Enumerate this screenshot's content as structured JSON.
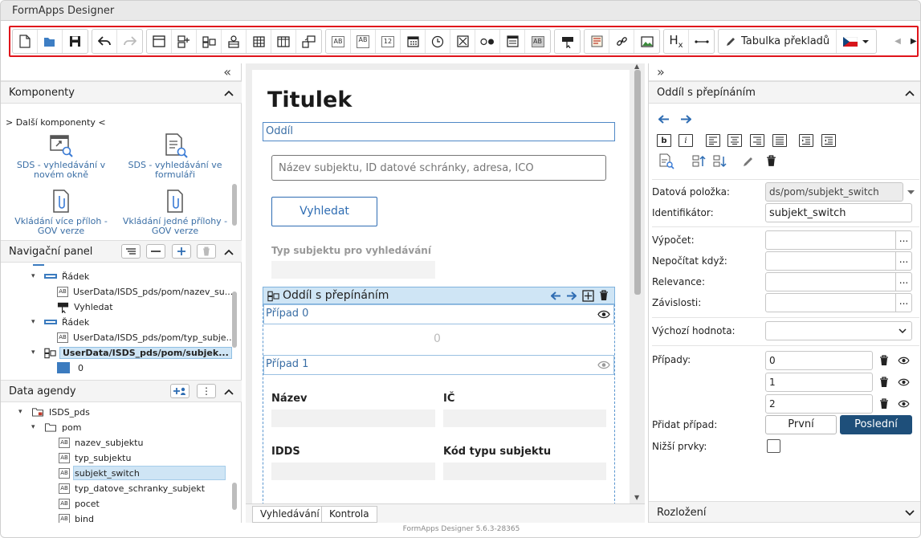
{
  "window": {
    "title": "FormApps Designer"
  },
  "toolbar": {
    "translations_label": "Tabulka překladů",
    "field_text_icon": "AB",
    "field_number_icon": "12",
    "field_readonly_icon": "AB",
    "field_textarea_icon": "AB",
    "heading_icon_letter": "H",
    "heading_icon_sub": "x",
    "language": "cs",
    "flag_colors": [
      "#ffffff",
      "#d7141a",
      "#11457e"
    ]
  },
  "left": {
    "components": {
      "title": "Komponenty",
      "more_link": "> Další komponenty <",
      "items": [
        {
          "label": "SDS - vyhledávání v novém okně",
          "icon": "window-search-icon"
        },
        {
          "label": "SDS - vyhledávání ve formuláři",
          "icon": "form-search-icon"
        },
        {
          "label": "Vkládání více příloh - GOV verze",
          "icon": "attachment-multi-icon"
        },
        {
          "label": "Vkládání jedné přílohy - GOV verze",
          "icon": "attachment-single-icon"
        }
      ]
    },
    "navigation": {
      "title": "Navigační panel",
      "rows": [
        {
          "label": "Řádek",
          "type": "row"
        },
        {
          "label": "UserData/ISDS_pds/pom/nazev_su...",
          "type": "field"
        },
        {
          "label": "Vyhledat",
          "type": "button"
        },
        {
          "label": "Řádek",
          "type": "row"
        },
        {
          "label": "UserData/ISDS_pds/pom/typ_subje...",
          "type": "field"
        },
        {
          "label": "UserData/ISDS_pds/pom/subjek...",
          "type": "switch"
        },
        {
          "label": "0",
          "type": "case"
        }
      ]
    },
    "data": {
      "title": "Data agendy",
      "rows": [
        {
          "label": "ISDS_pds",
          "type": "folder"
        },
        {
          "label": "pom",
          "type": "folder"
        },
        {
          "label": "nazev_subjektu",
          "type": "field"
        },
        {
          "label": "typ_subjektu",
          "type": "field"
        },
        {
          "label": "subjekt_switch",
          "type": "field"
        },
        {
          "label": "typ_datove_schranky_subjekt",
          "type": "field"
        },
        {
          "label": "pocet",
          "type": "field"
        },
        {
          "label": "bind",
          "type": "field"
        }
      ]
    }
  },
  "canvas": {
    "title": "Titulek",
    "section": "Oddíl",
    "search_placeholder": "Název subjektu, ID datové schránky, adresa, IČO",
    "search_button": "Vyhledat",
    "subject_type_label": "Typ subjektu pro vyhledávání",
    "switch_label": "Oddíl s přepínáním",
    "case0": "Případ 0",
    "case0_value": "0",
    "case1": "Případ 1",
    "fields": {
      "nazev": "Název",
      "ic": "IČ",
      "idds": "IDDS",
      "kod": "Kód typu subjektu"
    },
    "tabs": [
      "Vyhledávání",
      "Kontrola"
    ]
  },
  "right": {
    "title": "Oddíl s přepínáním",
    "data_item_label": "Datová položka:",
    "data_item_value": "ds/pom/subjekt_switch",
    "identifier_label": "Identifikátor:",
    "identifier_value": "subjekt_switch",
    "calc_label": "Výpočet:",
    "no_calc_label": "Nepočítat když:",
    "relevance_label": "Relevance:",
    "dependencies_label": "Závislosti:",
    "default_label": "Výchozí hodnota:",
    "cases_label": "Případy:",
    "cases": [
      "0",
      "1",
      "2"
    ],
    "add_case_label": "Přidat případ:",
    "add_first": "První",
    "add_last": "Poslední",
    "lower_elements_label": "Nižší prvky:",
    "layout_title": "Rozložení",
    "dots": "..."
  },
  "footer": {
    "version": "FormApps Designer 5.6.3-28365"
  },
  "colors": {
    "accent": "#1e4f7a",
    "link": "#3a6ea5",
    "highlight": "#cfe5f5",
    "arrow": "#2f6db3",
    "border_red": "#e0141b"
  }
}
